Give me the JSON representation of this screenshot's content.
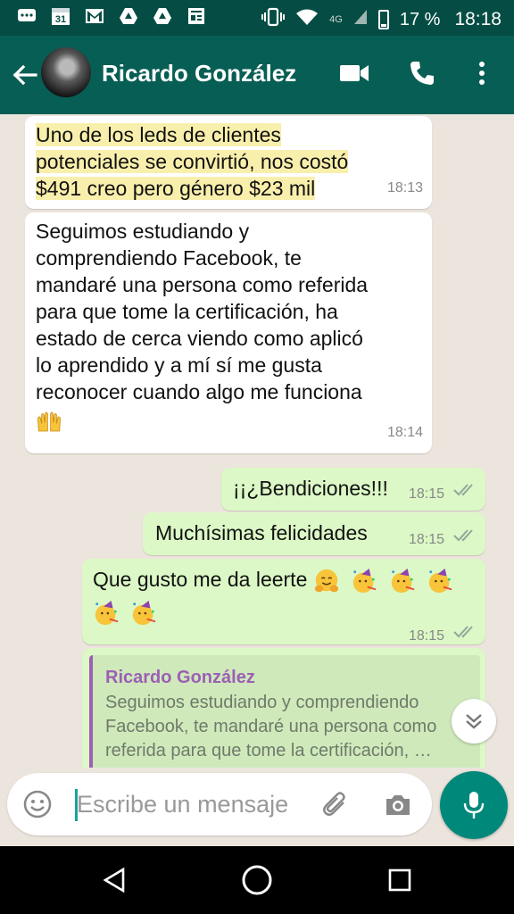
{
  "status_bar": {
    "date_badge": "31",
    "network": "4G",
    "battery": "17 %",
    "time": "18:18"
  },
  "header": {
    "contact_name": "Ricardo González"
  },
  "messages": [
    {
      "text_lines": [
        "Uno de los leds de clientes",
        "potenciales se convirtió, nos costó",
        "$491 creo pero género $23 mil"
      ],
      "time": "18:13"
    },
    {
      "text_lines": [
        "Seguimos estudiando y",
        "comprendiendo Facebook, te",
        "mandaré una persona como referida",
        "para que tome la certificación, ha",
        "estado de cerca viendo como aplicó",
        "lo aprendido y a mí sí me gusta",
        "reconocer cuando algo me funciona"
      ],
      "emoji": "raising-hands",
      "time": "18:14"
    },
    {
      "text": "¡¡¿Bendiciones!!!",
      "time": "18:15"
    },
    {
      "text": "Muchísimas felicidades",
      "time": "18:15"
    },
    {
      "text": "Que gusto me da leerte",
      "emojis": [
        "hugging-face",
        "partying-face",
        "partying-face",
        "partying-face",
        "partying-face",
        "partying-face"
      ],
      "time": "18:15"
    }
  ],
  "reply_preview": {
    "author": "Ricardo González",
    "lines": [
      "Seguimos estudiando y comprendiendo",
      "Facebook, te mandaré una persona como",
      "referida para que tome la certificación, …"
    ]
  },
  "input": {
    "placeholder": "Escribe un mensaje"
  },
  "colors": {
    "header": "#075e54",
    "status_bar": "#054d44",
    "chat_background": "#ece5dd",
    "incoming_bubble": "#ffffff",
    "outgoing_bubble": "#dcf8c6",
    "highlight": "#f9efac",
    "mic_button": "#00897b",
    "reply_accent": "#9c5fb5"
  }
}
